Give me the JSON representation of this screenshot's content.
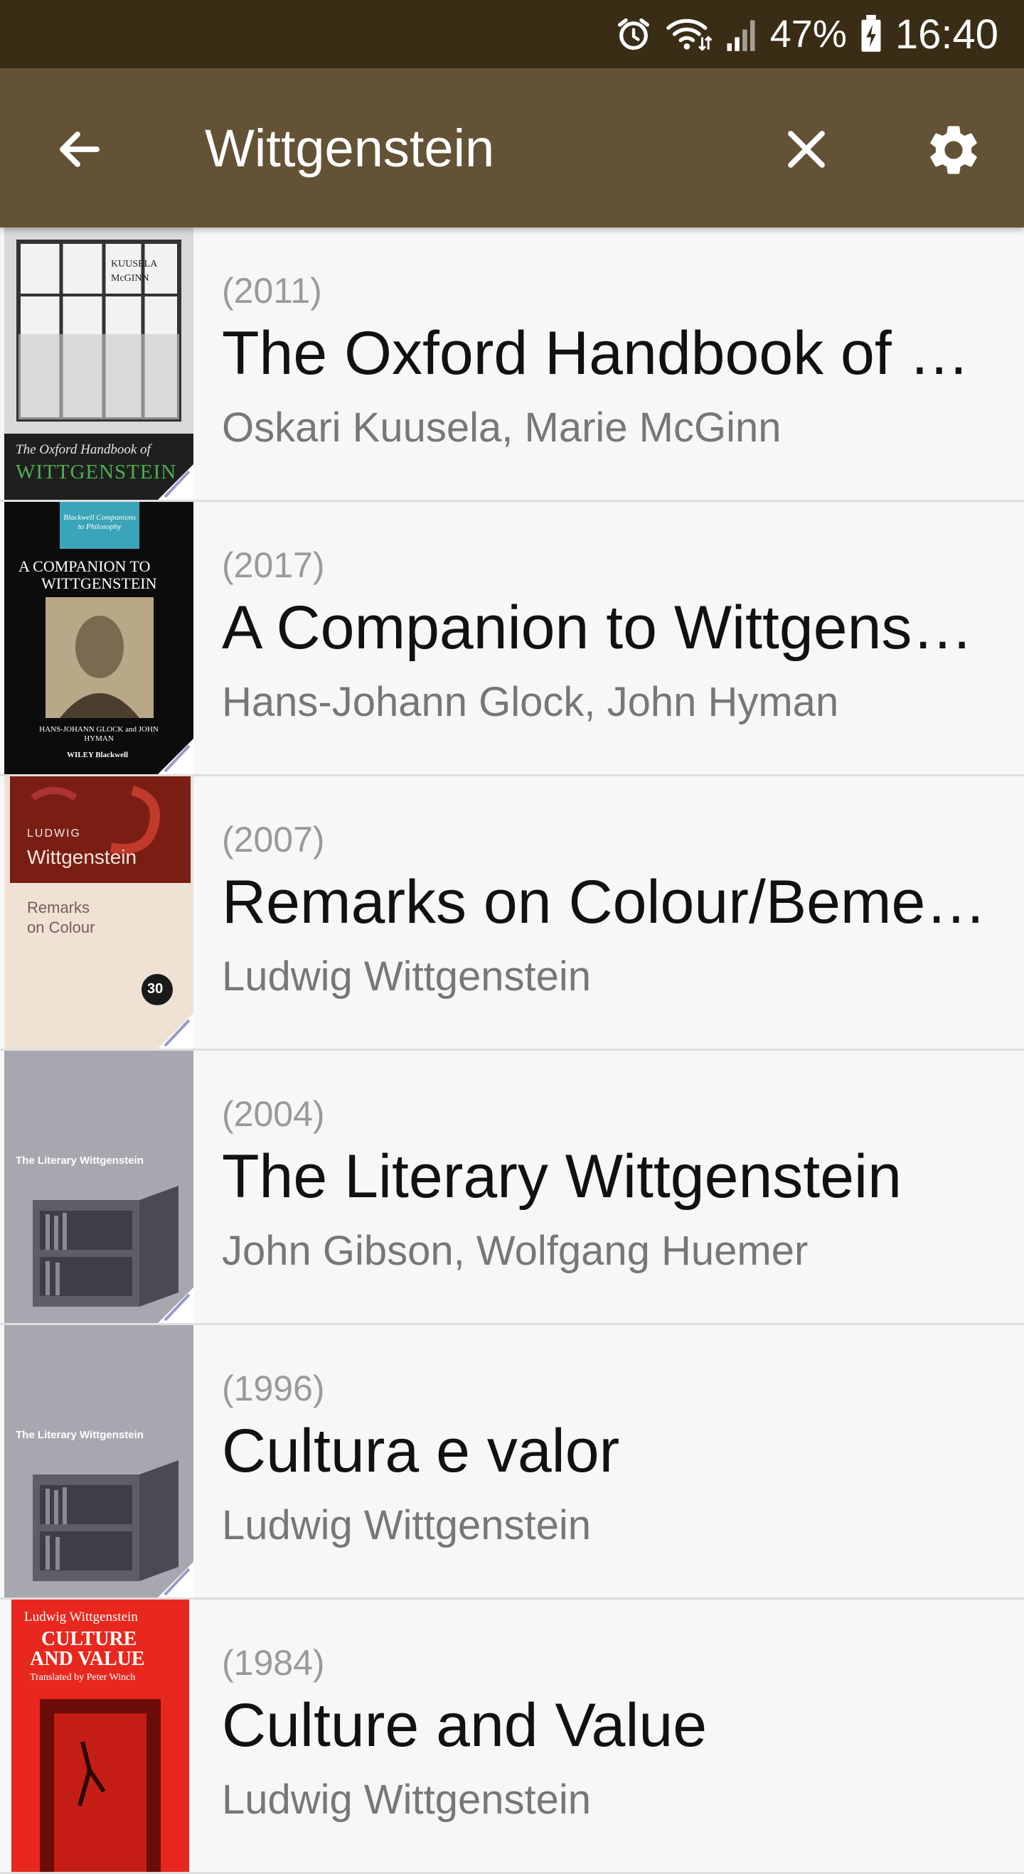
{
  "status_bar": {
    "battery": "47%",
    "time": "16:40",
    "icons": [
      "alarm-icon",
      "wifi-icon",
      "signal-icon",
      "battery-icon"
    ]
  },
  "app_bar": {
    "search_query": "Wittgenstein",
    "icons": [
      "back-arrow-icon",
      "clear-icon",
      "settings-icon"
    ]
  },
  "colors": {
    "status_bar_bg": "#3a2d16",
    "app_bar_bg": "#635235",
    "list_bg": "#f7f7f7"
  },
  "results": [
    {
      "year": "(2011)",
      "title": "The Oxford Handbook of …",
      "authors": "Oskari Kuusela, Marie McGinn",
      "cover": {
        "line1": "The Oxford Handbook of",
        "line2": "WITTGENSTEIN",
        "line3": "KUUSELA",
        "line4": "McGINN"
      }
    },
    {
      "year": "(2017)",
      "title": "A Companion to Wittgenst…",
      "authors": "Hans-Johann Glock, John Hyman",
      "cover": {
        "series": "Blackwell Companions to Philosophy",
        "line1": "A COMPANION TO",
        "line2": "WITTGENSTEIN",
        "editors": "HANS-JOHANN GLOCK and JOHN HYMAN",
        "publisher": "WILEY Blackwell"
      }
    },
    {
      "year": "(2007)",
      "title": "Remarks on Colour/Beme…",
      "authors": "Ludwig Wittgenstein",
      "cover": {
        "line1": "LUDWIG",
        "line2": "Wittgenstein",
        "line3": "Remarks",
        "line4": "on Colour",
        "badge": "30"
      }
    },
    {
      "year": "(2004)",
      "title": "The Literary Wittgenstein",
      "authors": "John Gibson, Wolfgang Huemer",
      "cover": {
        "line1": "The Literary Wittgenstein"
      }
    },
    {
      "year": "(1996)",
      "title": "Cultura e valor",
      "authors": "Ludwig Wittgenstein",
      "cover": {
        "line1": "The Literary Wittgenstein"
      }
    },
    {
      "year": "(1984)",
      "title": "Culture and Value",
      "authors": "Ludwig Wittgenstein",
      "cover": {
        "line1": "Ludwig Wittgenstein",
        "line2": "CULTURE",
        "line3": "AND VALUE",
        "line4": "Translated by Peter Winch"
      }
    }
  ]
}
